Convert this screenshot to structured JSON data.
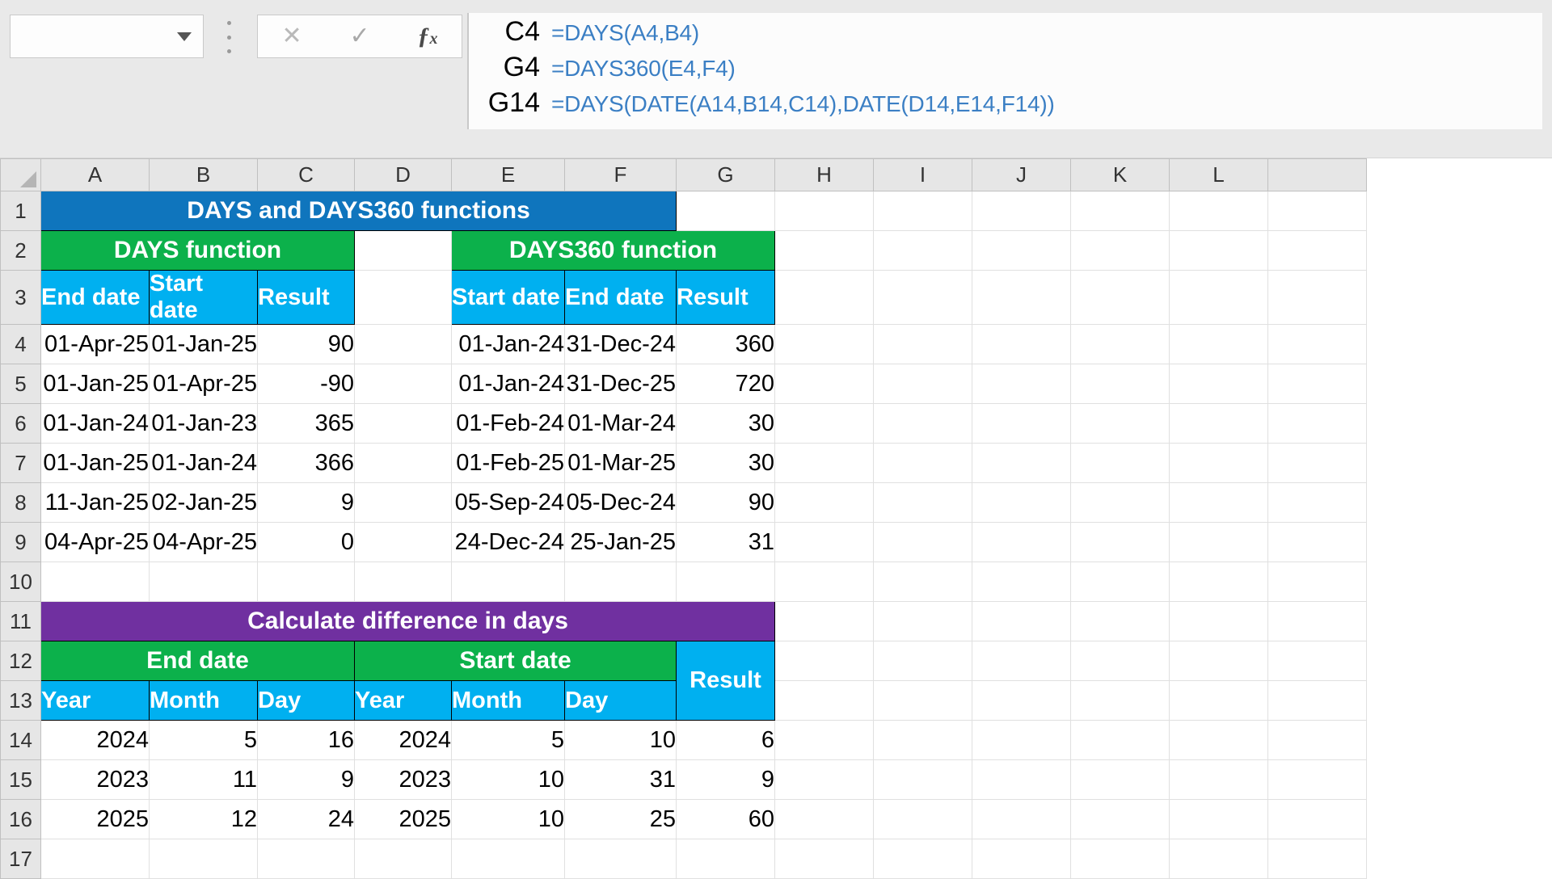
{
  "formula_bar": {
    "name_box_value": "",
    "cancel_icon": "close-icon",
    "confirm_icon": "check-icon",
    "fx_icon": "fx-icon"
  },
  "notes": [
    {
      "ref": "C4",
      "formula": "=DAYS(A4,B4)"
    },
    {
      "ref": "G4",
      "formula": "=DAYS360(E4,F4)"
    },
    {
      "ref": "G14",
      "formula": "=DAYS(DATE(A14,B14,C14),DATE(D14,E14,F14))"
    }
  ],
  "sheet": {
    "column_headers": [
      "A",
      "B",
      "C",
      "D",
      "E",
      "F",
      "G",
      "H",
      "I",
      "J",
      "K",
      "L"
    ],
    "row_headers": [
      "1",
      "2",
      "3",
      "4",
      "5",
      "6",
      "7",
      "8",
      "9",
      "10",
      "11",
      "12",
      "13",
      "14",
      "15",
      "16",
      "17"
    ],
    "colors": {
      "title_blue": "#0f75bd",
      "section_green": "#0cb14b",
      "header_cyan": "#00b0f0",
      "section_purple": "#7030a0"
    },
    "titles": {
      "main_title": "DAYS and DAYS360 functions",
      "days_section": "DAYS function",
      "days360_section": "DAYS360 function",
      "diff_title": "Calculate difference in days",
      "end_date_group": "End date",
      "start_date_group": "Start date"
    },
    "table1": {
      "headers_left": [
        "End date",
        "Start date",
        "Result"
      ],
      "headers_right": [
        "Start date",
        "End date",
        "Result"
      ],
      "rows_left": [
        [
          "01-Apr-25",
          "01-Jan-25",
          "90"
        ],
        [
          "01-Jan-25",
          "01-Apr-25",
          "-90"
        ],
        [
          "01-Jan-24",
          "01-Jan-23",
          "365"
        ],
        [
          "01-Jan-25",
          "01-Jan-24",
          "366"
        ],
        [
          "11-Jan-25",
          "02-Jan-25",
          "9"
        ],
        [
          "04-Apr-25",
          "04-Apr-25",
          "0"
        ]
      ],
      "rows_right": [
        [
          "01-Jan-24",
          "31-Dec-24",
          "360"
        ],
        [
          "01-Jan-24",
          "31-Dec-25",
          "720"
        ],
        [
          "01-Feb-24",
          "01-Mar-24",
          "30"
        ],
        [
          "01-Feb-25",
          "01-Mar-25",
          "30"
        ],
        [
          "05-Sep-24",
          "05-Dec-24",
          "90"
        ],
        [
          "24-Dec-24",
          "25-Jan-25",
          "31"
        ]
      ]
    },
    "table2": {
      "headers": [
        "Year",
        "Month",
        "Day",
        "Year",
        "Month",
        "Day"
      ],
      "result_header": "Result",
      "rows": [
        [
          "2024",
          "5",
          "16",
          "2024",
          "5",
          "10",
          "6"
        ],
        [
          "2023",
          "11",
          "9",
          "2023",
          "10",
          "31",
          "9"
        ],
        [
          "2025",
          "12",
          "24",
          "2025",
          "10",
          "25",
          "60"
        ]
      ]
    }
  }
}
